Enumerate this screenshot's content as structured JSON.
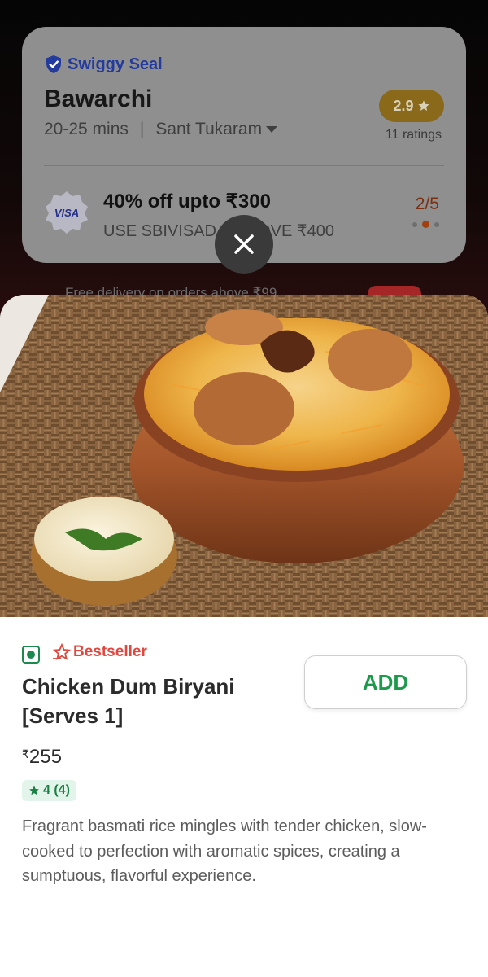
{
  "restaurant": {
    "seal": "Swiggy Seal",
    "name": "Bawarchi",
    "delivery_time": "20-25 mins",
    "location": "Sant Tukaram",
    "rating": "2.9",
    "ratings_count": "11 ratings"
  },
  "offer": {
    "badge": "VISA",
    "title": "40% off upto ₹300",
    "code_text": "USE SBIVISAD…  ABOVE ₹400",
    "pager": "2/5"
  },
  "peek": {
    "text": "Free delivery on orders above ₹99"
  },
  "item": {
    "bestseller": "Bestseller",
    "name": "Chicken Dum Biryani [Serves 1]",
    "currency": "₹",
    "price": "255",
    "rating": "4 (4)",
    "add_label": "ADD",
    "description": "Fragrant basmati rice mingles with tender chicken, slow-cooked to perfection with aromatic spices, creating a sumptuous, flavorful experience."
  },
  "colors": {
    "seal_blue": "#233a9e",
    "add_green": "#1b9a4a",
    "bestseller_red": "#e0483e",
    "veg_green": "#1c8a4e",
    "rating_gold": "#8a6a1a"
  }
}
